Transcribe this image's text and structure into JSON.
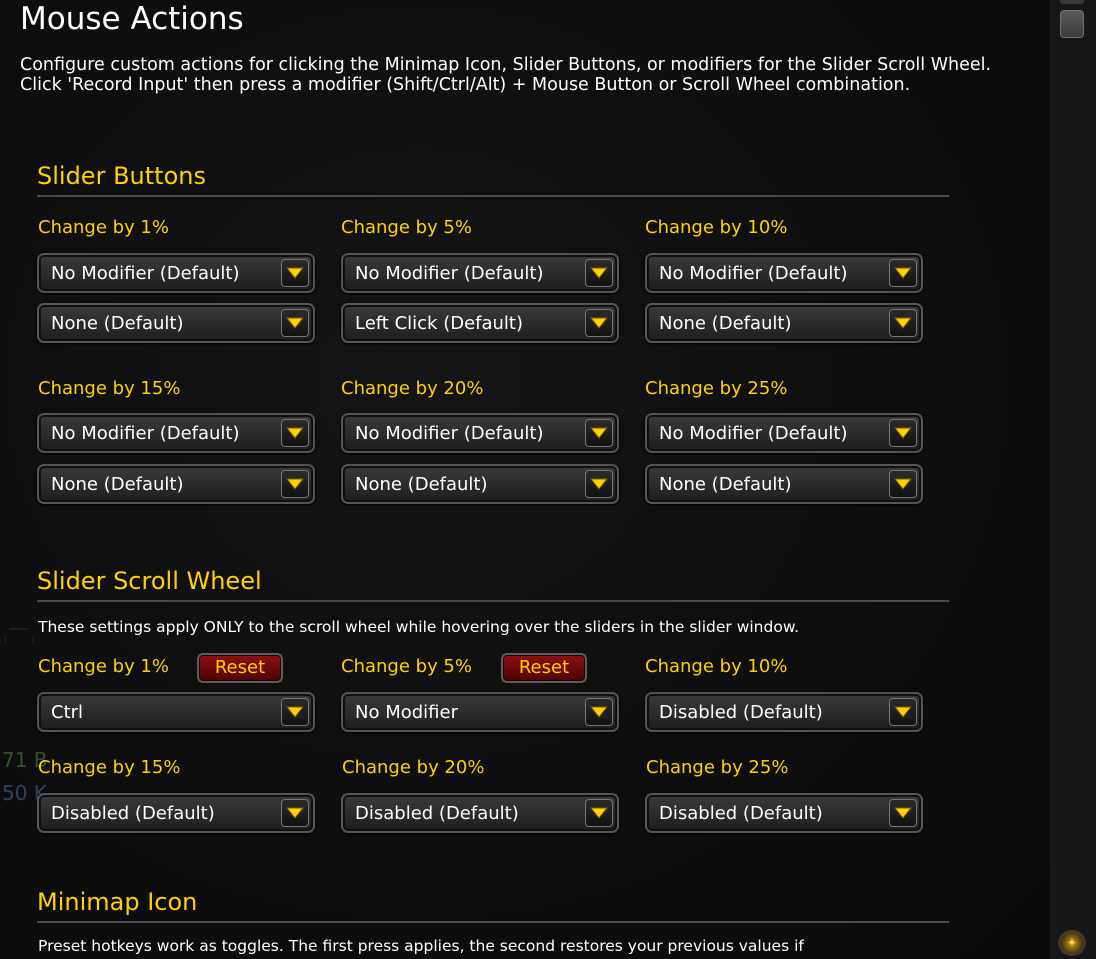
{
  "page": {
    "title": "Mouse Actions",
    "intro": "Configure custom actions for clicking the Minimap Icon, Slider Buttons, or modifiers for the Slider Scroll Wheel. Click 'Record Input' then press a modifier (Shift/Ctrl/Alt) + Mouse Button or Scroll Wheel combination."
  },
  "slider_buttons": {
    "heading": "Slider Buttons",
    "items": [
      {
        "label": "Change by 1%",
        "modifier": "No Modifier (Default)",
        "button": "None (Default)"
      },
      {
        "label": "Change by 5%",
        "modifier": "No Modifier (Default)",
        "button": "Left Click (Default)"
      },
      {
        "label": "Change by 10%",
        "modifier": "No Modifier (Default)",
        "button": "None (Default)"
      },
      {
        "label": "Change by 15%",
        "modifier": "No Modifier (Default)",
        "button": "None (Default)"
      },
      {
        "label": "Change by 20%",
        "modifier": "No Modifier (Default)",
        "button": "None (Default)"
      },
      {
        "label": "Change by 25%",
        "modifier": "No Modifier (Default)",
        "button": "None (Default)"
      }
    ]
  },
  "scroll_wheel": {
    "heading": "Slider Scroll Wheel",
    "description": "These settings apply ONLY to the scroll wheel while hovering over the sliders in the slider window.",
    "reset_label": "Reset",
    "items": [
      {
        "label": "Change by 1%",
        "value": "Ctrl"
      },
      {
        "label": "Change by 5%",
        "value": "No Modifier"
      },
      {
        "label": "Change by 10%",
        "value": "Disabled (Default)"
      },
      {
        "label": "Change by 15%",
        "value": "Disabled (Default)"
      },
      {
        "label": "Change by 20%",
        "value": "Disabled (Default)"
      },
      {
        "label": "Change by 25%",
        "value": "Disabled (Default)"
      }
    ]
  },
  "minimap": {
    "heading": "Minimap Icon",
    "description": "Preset hotkeys work as toggles. The first press applies, the second restores your previous values if"
  },
  "background": {
    "artifact_1": "71 B",
    "artifact_2": "50 K"
  },
  "colors": {
    "accent": "#ffd100",
    "reset_bg": "#8e1010"
  }
}
